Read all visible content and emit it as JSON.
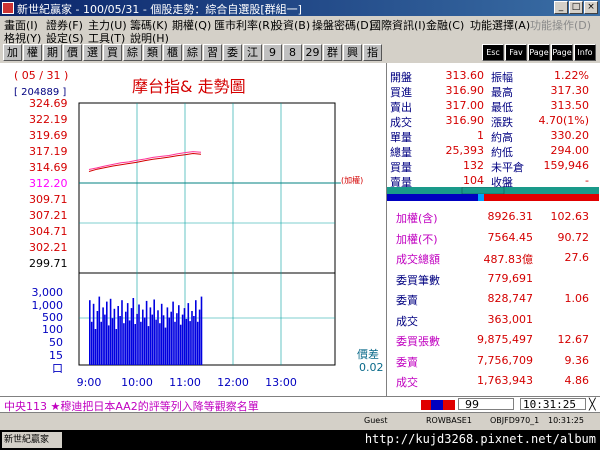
{
  "window": {
    "title": "新世紀贏家 - 100/05/31 - 個股走勢：綜合自選股[群組一]"
  },
  "menu": {
    "row1": [
      "畫面(I)",
      "證券(F)",
      "主力(U)",
      "籌碼(K)",
      "期權(Q)",
      "匯市利率(R)",
      "投資(B)",
      "操盤密碼(D)",
      "國際資訊(I)",
      "金融(C)",
      "功能選擇(A)",
      "功能操作(D)"
    ],
    "row2": [
      "格視(Y)",
      "設定(S)",
      "工具(T)",
      "說明(H)"
    ]
  },
  "toolbar": {
    "buttons": [
      "加",
      "權",
      "期",
      "價",
      "選",
      "買",
      "綜",
      "類",
      "櫃",
      "綜",
      "習",
      "委",
      "江",
      "9",
      "8",
      "29",
      "群",
      "興",
      "指"
    ],
    "icon_labels": [
      "Esc",
      "Fav",
      "Page Up",
      "Page Dn",
      "Info"
    ]
  },
  "chart": {
    "date": "( 05 / 31 )",
    "volume_box": "[ 204889 ]",
    "title": "摩台指& 走勢圖",
    "ref_tag": "(加權)",
    "diff_label": "價差",
    "diff_value": "0.02",
    "price_colors": [
      "#d40000",
      "#d40000",
      "#d40000",
      "#d40000",
      "#d40000",
      "#ff00ff",
      "#d40000",
      "#d40000",
      "#d40000",
      "#d40000",
      "#000000"
    ]
  },
  "chart_data": {
    "type": "line",
    "y_ticks": [
      "324.69",
      "322.19",
      "319.69",
      "317.19",
      "314.69",
      "312.20",
      "309.71",
      "307.21",
      "304.71",
      "302.21",
      "299.71"
    ],
    "ylim": [
      299.71,
      324.69
    ],
    "reference_price": 312.2,
    "x_ticks": [
      "9:00",
      "10:00",
      "11:00",
      "12:00",
      "13:00"
    ],
    "series": [
      {
        "x": [
          0,
          10,
          20,
          30,
          40,
          50,
          60,
          70,
          80,
          90,
          100,
          110,
          120,
          130,
          140
        ],
        "values": [
          314.3,
          314.55,
          314.85,
          315.1,
          315.35,
          315.5,
          315.75,
          315.95,
          316.2,
          316.35,
          316.5,
          316.75,
          316.95,
          317.1,
          317.0
        ]
      },
      {
        "x": [
          0,
          10,
          20,
          30,
          40,
          50,
          60,
          70,
          80,
          90,
          100,
          110,
          120,
          130,
          140
        ],
        "values": [
          314.0,
          314.35,
          314.6,
          314.85,
          315.05,
          315.25,
          315.45,
          315.7,
          315.9,
          316.05,
          316.25,
          316.45,
          316.6,
          316.8,
          316.7
        ]
      }
    ],
    "volume_ticks": [
      "3,000",
      "1,000",
      "500",
      "100",
      "50",
      "15",
      "口"
    ],
    "volume_bars": [
      0.9,
      0.6,
      0.85,
      0.5,
      0.75,
      0.95,
      0.6,
      0.8,
      0.7,
      0.88,
      0.55,
      0.92,
      0.65,
      0.78,
      0.5,
      0.82,
      0.68,
      0.9,
      0.58,
      0.74,
      0.86,
      0.62,
      0.79,
      0.93,
      0.57,
      0.71,
      0.84,
      0.6,
      0.77,
      0.66,
      0.89,
      0.54,
      0.8,
      0.7,
      0.91,
      0.63,
      0.76,
      0.58,
      0.85,
      0.69,
      0.52,
      0.8,
      0.66,
      0.74,
      0.88,
      0.6,
      0.72,
      0.83,
      0.56,
      0.7,
      0.79,
      0.64,
      0.86,
      0.61,
      0.75,
      0.68,
      0.9,
      0.6,
      0.77,
      0.95
    ]
  },
  "quote": {
    "rows": [
      [
        "開盤",
        "313.60",
        "振幅",
        "1.22%"
      ],
      [
        "買進",
        "316.90",
        "最高",
        "317.30"
      ],
      [
        "賣出",
        "317.00",
        "最低",
        "313.50"
      ],
      [
        "成交",
        "316.90",
        "漲跌",
        "4.70(1%)"
      ],
      [
        "單量",
        "1",
        "約高",
        "330.20"
      ],
      [
        "總量",
        "25,393",
        "約低",
        "294.00"
      ],
      [
        "買量",
        "132",
        "未平倉",
        "159,946"
      ],
      [
        "賣量",
        "104",
        "收盤",
        "-"
      ]
    ],
    "colors": [
      [
        "#000080",
        "#d40000",
        "#000080",
        "#d40000"
      ],
      [
        "#000080",
        "#d40000",
        "#000080",
        "#d40000"
      ],
      [
        "#000080",
        "#d40000",
        "#000080",
        "#d40000"
      ],
      [
        "#000080",
        "#d40000",
        "#000080",
        "#d40000"
      ],
      [
        "#000080",
        "#d40000",
        "#000080",
        "#d40000"
      ],
      [
        "#000080",
        "#d40000",
        "#000080",
        "#d40000"
      ],
      [
        "#000080",
        "#d40000",
        "#000080",
        "#d40000"
      ],
      [
        "#000080",
        "#d40000",
        "#000080",
        "#d40000"
      ]
    ]
  },
  "board": {
    "rows": [
      [
        "加權(含)",
        "8926.31",
        "102.63"
      ],
      [
        "加權(不)",
        "7564.45",
        "90.72"
      ],
      [
        "成交總額",
        "487.83億",
        "27.6"
      ],
      [
        "委買筆數",
        "779,691",
        ""
      ],
      [
        "委賣",
        "828,747",
        "1.06"
      ],
      [
        "成交",
        "363,001",
        ""
      ],
      [
        "委買張數",
        "9,875,497",
        "12.67"
      ],
      [
        "委賣",
        "7,756,709",
        "9.36"
      ],
      [
        "成交",
        "1,763,943",
        "4.86"
      ]
    ],
    "label_colors": [
      "#c000c0",
      "#c000c0",
      "#c000c0",
      "#000080",
      "#000080",
      "#000080",
      "#c000c0",
      "#c000c0",
      "#c000c0"
    ]
  },
  "ticker": {
    "text": "中央113  ★穆迪把日本AA2的評等列入降等觀察名單",
    "code": "99",
    "time": "10:31:25"
  },
  "status": {
    "fields": [
      "Guest",
      "ROWBASE1",
      "OBJFD970_1",
      "10:31:25"
    ]
  },
  "taskbar": {
    "task_label": "新世紀贏家",
    "url": "http://kujd3268.pixnet.net/album"
  }
}
